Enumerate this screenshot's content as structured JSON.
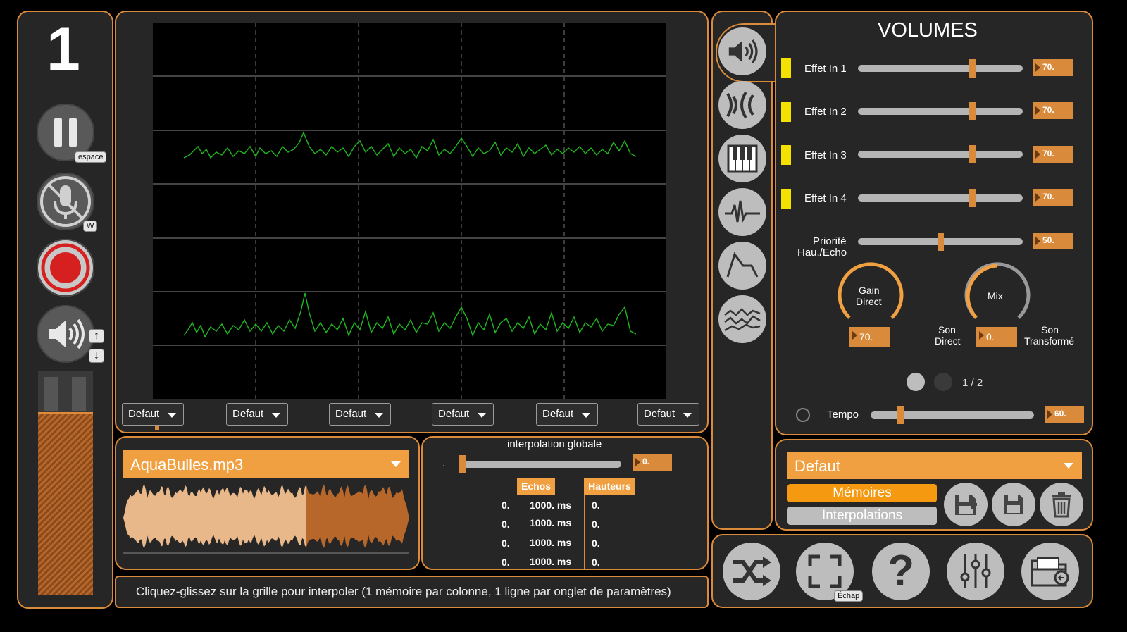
{
  "left": {
    "channel_number": "1",
    "pause_key": "espace",
    "mic_key": "W",
    "volume_up_key": "↑",
    "volume_down_key": "↓"
  },
  "grid": {
    "dropdowns": [
      "Defaut",
      "Defaut",
      "Defaut",
      "Defaut",
      "Defaut",
      "Defaut"
    ]
  },
  "file": {
    "name": "AquaBulles.mp3",
    "playback_progress": 0.64
  },
  "interp": {
    "title": "interpolation globale",
    "slider_min_label": ".",
    "value": "0.",
    "echos_header": "Echos",
    "hauteurs_header": "Hauteurs",
    "rows": [
      {
        "a": "0.",
        "ms": "1000. ms",
        "h": "0."
      },
      {
        "a": "0.",
        "ms": "1000. ms",
        "h": "0."
      },
      {
        "a": "0.",
        "ms": "1000. ms",
        "h": "0."
      },
      {
        "a": "0.",
        "ms": "1000. ms",
        "h": "0."
      }
    ]
  },
  "status_bar": "Cliquez-glissez sur la grille pour interpoler (1 mémoire par colonne, 1 ligne par onglet de paramètres)",
  "volumes": {
    "title": "VOLUMES",
    "effects": [
      {
        "label": "Effet In 1",
        "value": "70.",
        "level": 0.7
      },
      {
        "label": "Effet In 2",
        "value": "70.",
        "level": 0.7
      },
      {
        "label": "Effet In 3",
        "value": "70.",
        "level": 0.7
      },
      {
        "label": "Effet In 4",
        "value": "70.",
        "level": 0.7
      }
    ],
    "priority_label_1": "Priorité",
    "priority_label_2": "Hau./Echo",
    "priority_value": "50.",
    "priority_level": 0.5,
    "gain_label_1": "Gain",
    "gain_label_2": "Direct",
    "gain_value": "70.",
    "mix_label": "Mix",
    "mix_value": "0.",
    "son_direct_1": "Son",
    "son_direct_2": "Direct",
    "son_transforme_1": "Son",
    "son_transforme_2": "Transformé",
    "page": "1 / 2",
    "tempo_label": "Tempo",
    "tempo_value": "60.",
    "tempo_level": 0.17
  },
  "presets": {
    "selected": "Defaut",
    "memoires": "Mémoires",
    "interpolations": "Interpolations"
  },
  "bottom": {
    "fullscreen_key": "Échap"
  },
  "colors": {
    "accent": "#d98a3a",
    "panel": "#262626",
    "led": "#f5e100",
    "wave": "#1fb81f",
    "record": "#d62020"
  },
  "icons": {
    "tabs": [
      "speaker-icon",
      "echo-icon",
      "piano-icon",
      "waveform-icon",
      "envelope-icon",
      "spectrum-icon"
    ],
    "bottom": [
      "shuffle-icon",
      "fullscreen-icon",
      "help-icon",
      "mixer-icon",
      "folder-icon"
    ]
  }
}
